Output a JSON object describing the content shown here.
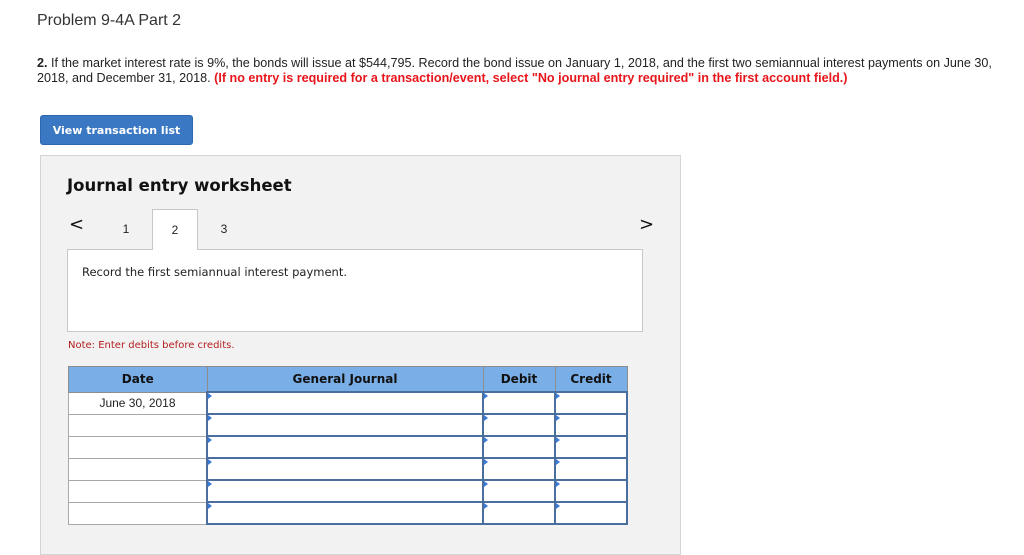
{
  "header": {
    "title": "Problem 9-4A Part 2"
  },
  "question": {
    "number": "2.",
    "text": " If the market interest rate is 9%, the bonds will issue at $544,795. Record the bond issue on January 1, 2018, and the first two semiannual interest payments on June 30, 2018, and December 31, 2018. ",
    "instruction": "(If no entry is required for a transaction/event, select \"No journal entry required\" in the first account field.)"
  },
  "buttons": {
    "view_transaction_list": "View transaction list"
  },
  "worksheet": {
    "title": "Journal entry worksheet",
    "nav_prev": "<",
    "nav_next": ">",
    "tabs": [
      {
        "label": "1",
        "active": false
      },
      {
        "label": "2",
        "active": true
      },
      {
        "label": "3",
        "active": false
      }
    ],
    "description": "Record the first semiannual interest payment.",
    "note": "Note: Enter debits before credits.",
    "table": {
      "headers": [
        "Date",
        "General Journal",
        "Debit",
        "Credit"
      ],
      "rows": [
        {
          "date": "June 30, 2018",
          "account": "",
          "debit": "",
          "credit": ""
        },
        {
          "date": "",
          "account": "",
          "debit": "",
          "credit": ""
        },
        {
          "date": "",
          "account": "",
          "debit": "",
          "credit": ""
        },
        {
          "date": "",
          "account": "",
          "debit": "",
          "credit": ""
        },
        {
          "date": "",
          "account": "",
          "debit": "",
          "credit": ""
        },
        {
          "date": "",
          "account": "",
          "debit": "",
          "credit": ""
        }
      ]
    }
  },
  "colors": {
    "accent": "#3a78c3",
    "header_fill": "#7aaee6",
    "instruction_red": "#e8151b",
    "note_red": "#b41e1e"
  }
}
